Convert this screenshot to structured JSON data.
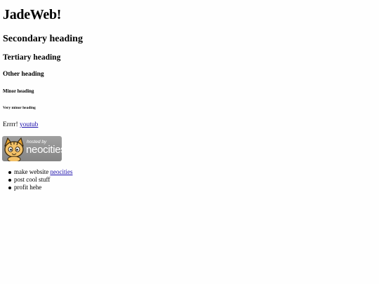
{
  "headings": {
    "h1": "JadeWeb!",
    "h2": "Secondary heading",
    "h3": "Tertiary heading",
    "h4": "Other heading",
    "h5": "Minor heading",
    "h6": "Very minor heading"
  },
  "paragraph": {
    "text": "Errrr!",
    "link_label": "youtub"
  },
  "badge": {
    "line1": "hosted by",
    "line2": "neocities"
  },
  "list": [
    {
      "text": "make website",
      "link": "neocities"
    },
    {
      "text": "post cool stuff"
    },
    {
      "text": "profit hehe"
    }
  ],
  "colors": {
    "link": "#1a0dab",
    "badge_bg": "#929292",
    "cat": "#e8a330"
  }
}
